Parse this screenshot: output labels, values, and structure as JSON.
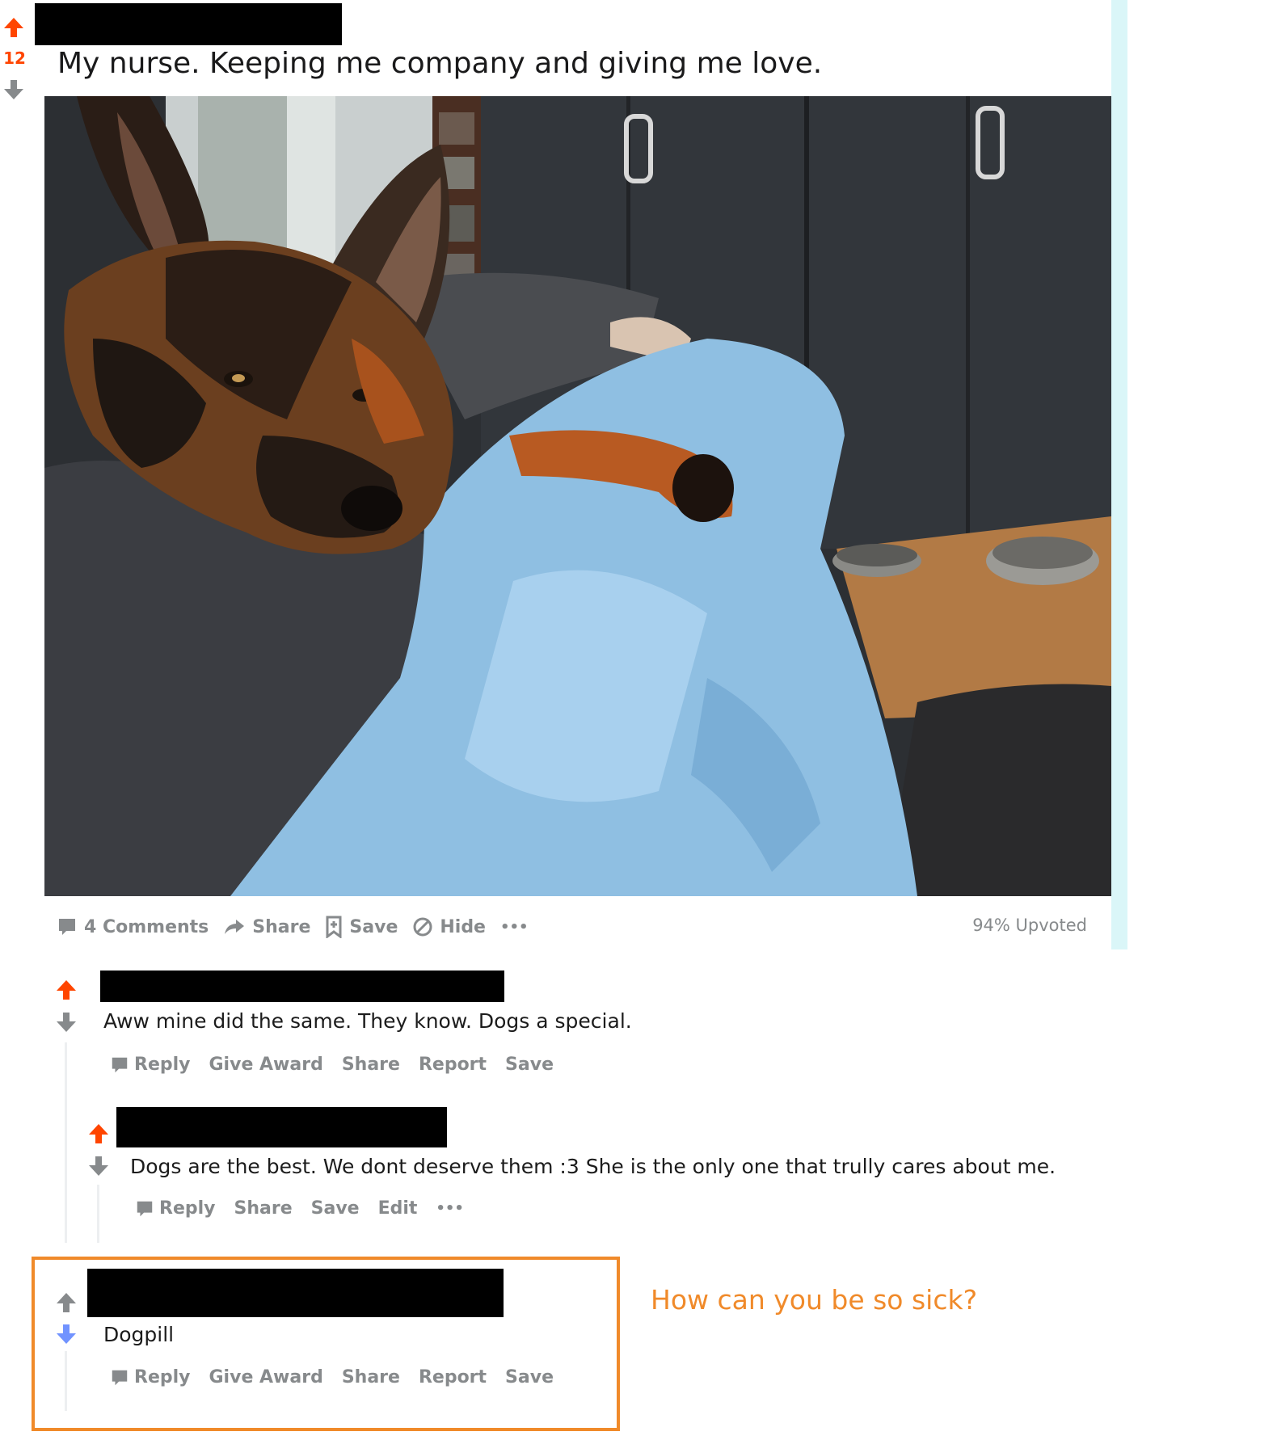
{
  "colors": {
    "upvote": "#ff4500",
    "downvote_active": "#7193ff",
    "neutral": "#878a8c",
    "annotation": "#f08a2a"
  },
  "post": {
    "score": "12",
    "title": "My nurse. Keeping me company and giving me love.",
    "image_alt": "German shepherd lying on a person in bed under a light blue blanket",
    "actions": {
      "comments": "4 Comments",
      "share": "Share",
      "save": "Save",
      "hide": "Hide",
      "more": "•••"
    },
    "upvoted": "94% Upvoted"
  },
  "comments": [
    {
      "body": "Aww mine did the same. They know. Dogs a special.",
      "actions": [
        "Reply",
        "Give Award",
        "Share",
        "Report",
        "Save"
      ],
      "vote": "upvoted"
    },
    {
      "body": "Dogs are the best. We dont deserve them :3 She is the only one that trully cares about me.",
      "actions": [
        "Reply",
        "Share",
        "Save",
        "Edit",
        "•••"
      ],
      "vote": "upvoted"
    },
    {
      "body": "Dogpill",
      "actions": [
        "Reply",
        "Give Award",
        "Share",
        "Report",
        "Save"
      ],
      "vote": "downvoted"
    }
  ],
  "annotation": "How can you be so sick?",
  "icons": {
    "upvote": "arrow-up-icon",
    "downvote": "arrow-down-icon",
    "comment": "comment-bubble-icon",
    "share": "share-arrow-icon",
    "save": "bookmark-plus-icon",
    "hide": "hide-circle-slash-icon"
  }
}
